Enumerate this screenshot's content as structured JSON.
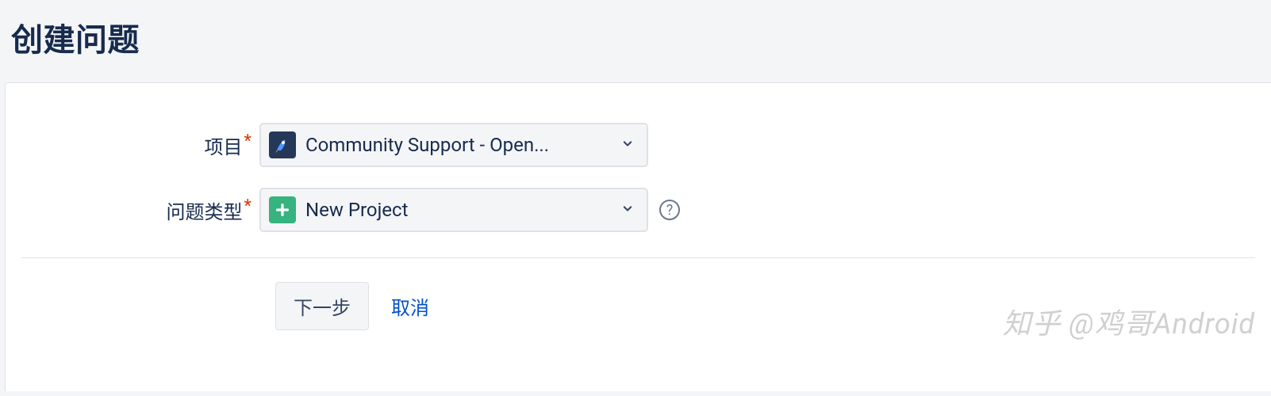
{
  "header": {
    "title": "创建问题"
  },
  "form": {
    "project": {
      "label": "项目",
      "selected": "Community Support - Open..."
    },
    "issue_type": {
      "label": "问题类型",
      "selected": "New Project"
    }
  },
  "actions": {
    "next": "下一步",
    "cancel": "取消"
  },
  "watermark": "知乎 @鸡哥Android"
}
